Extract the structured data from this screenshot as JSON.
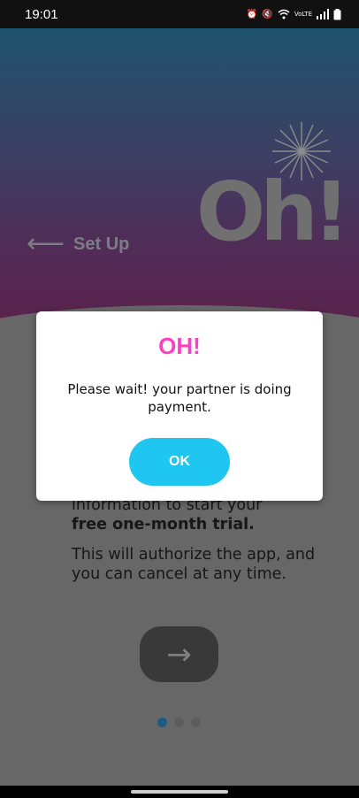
{
  "status_bar": {
    "time": "19:01",
    "icons": [
      "alarm-icon",
      "mute-icon",
      "wifi-icon",
      "volte-icon",
      "signal-icon",
      "battery-icon"
    ],
    "volte_label": "VoLTE"
  },
  "header": {
    "back_arrow": "⟵",
    "back_label": "Set Up",
    "logo_text": "Oh!"
  },
  "body": {
    "line1": "information to start your",
    "line2": "free one-month trial.",
    "paragraph2": "This will authorize the app, and you can cancel at any time.",
    "next_arrow": "→"
  },
  "pager": {
    "count": 3,
    "active_index": 0
  },
  "dialog": {
    "title": "OH!",
    "message": "Please wait! your partner is doing payment.",
    "ok_label": "OK"
  },
  "colors": {
    "accent_pink": "#ff3ec8",
    "button_cyan": "#1fc6ef",
    "dot_active": "#2b86c4"
  }
}
